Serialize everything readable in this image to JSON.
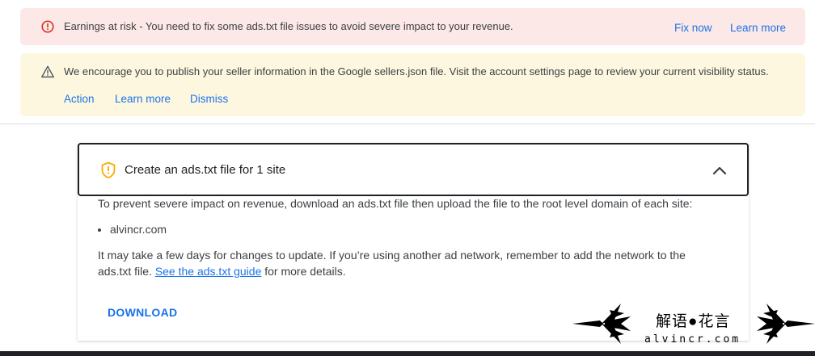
{
  "error_banner": {
    "message": "Earnings at risk - You need to fix some ads.txt file issues to avoid severe impact to your revenue.",
    "fix_now": "Fix now",
    "learn_more": "Learn more",
    "icon": "error-circle-icon",
    "color": "#d93025",
    "background": "#fce8e6"
  },
  "warning_banner": {
    "message": "We encourage you to publish your seller information in the Google sellers.json file. Visit the account settings page to review your current visibility status.",
    "action": "Action",
    "learn_more": "Learn more",
    "dismiss": "Dismiss",
    "icon": "warning-triangle-icon",
    "background": "#fef7e0"
  },
  "card": {
    "title": "Create an ads.txt file for 1 site",
    "shield_icon": "shield-warning-icon",
    "shield_color": "#f9ab00",
    "intro": "To prevent severe impact on revenue, download an ads.txt file then upload the file to the root level domain of each site:",
    "sites": [
      "alvincr.com"
    ],
    "note_line1": "It may take a few days for changes to update. If you’re using another ad network, remember to add the network to the",
    "note_prefix": "ads.txt file. ",
    "guide_link": "See the ads.txt guide",
    "note_suffix": " for more details.",
    "download": "DOWNLOAD"
  },
  "watermark": {
    "cn": "解语●花言",
    "en": "alvincr.com"
  },
  "accent_color": "#1a73e8"
}
